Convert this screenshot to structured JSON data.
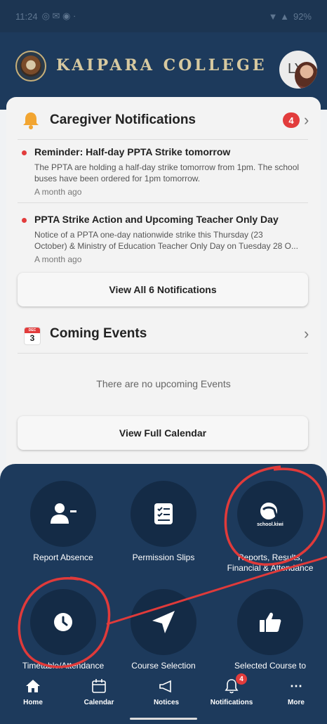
{
  "status_bar": {
    "time": "11:24",
    "battery": "92%"
  },
  "header": {
    "title": "KAIPARA COLLEGE",
    "avatar_initials": "LY"
  },
  "notifications": {
    "title": "Caregiver Notifications",
    "count": "4",
    "items": [
      {
        "title": "Reminder: Half-day PPTA Strike tomorrow",
        "body": "The PPTA are holding a half-day strike tomorrow from 1pm. The school buses have been ordered for 1pm tomorrow.",
        "time": "A month ago"
      },
      {
        "title": "PPTA Strike Action and Upcoming Teacher Only Day",
        "body_line1": "Notice of a PPTA one-day nationwide strike this Thursday (23",
        "body_line2": "October) & Ministry of Education Teacher Only Day on Tuesday 28 O...",
        "time": "A month ago"
      }
    ],
    "view_all_label": "View All 6 Notifications"
  },
  "events": {
    "title": "Coming Events",
    "calendar_month": "DEC",
    "calendar_day": "3",
    "empty_text": "There are no upcoming Events",
    "view_calendar_label": "View Full Calendar"
  },
  "quick_links": [
    {
      "label": "Report Absence",
      "icon": "person-minus-icon"
    },
    {
      "label": "Permission Slips",
      "icon": "checklist-icon"
    },
    {
      "label_line1": "Reports, Results,",
      "label_line2": "Financial & Attendance",
      "icon": "school-kiwi-icon",
      "icon_text": "school.kiwi"
    },
    {
      "label": "Timetable/Attendance",
      "icon": "clock-icon"
    },
    {
      "label": "Course Selection",
      "icon": "navigation-arrow-icon"
    },
    {
      "label": "Selected Course to",
      "icon": "thumbs-up-icon"
    }
  ],
  "bottom_nav": [
    {
      "label": "Home",
      "icon": "home-icon"
    },
    {
      "label": "Calendar",
      "icon": "calendar-icon"
    },
    {
      "label": "Notices",
      "icon": "megaphone-icon"
    },
    {
      "label": "Notifications",
      "icon": "bell-icon",
      "badge": "4"
    },
    {
      "label": "More",
      "icon": "ellipsis-icon"
    }
  ],
  "colors": {
    "navy": "#1d3a5c",
    "navy_dark": "#142b46",
    "accent_red": "#e23c3c",
    "bell_orange": "#f2a531",
    "brand_gold": "#d7c9a0"
  }
}
